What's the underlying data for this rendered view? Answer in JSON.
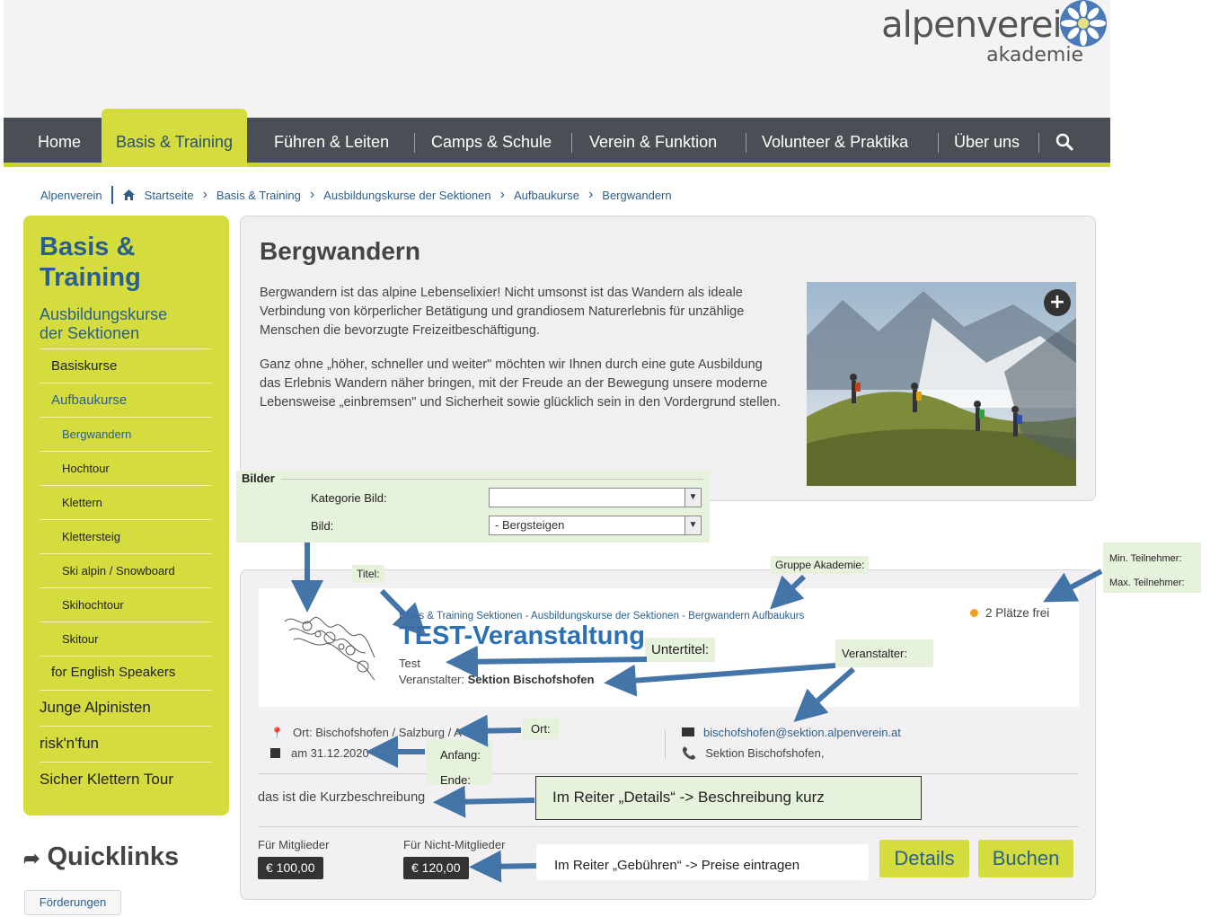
{
  "header": {
    "logo_main": "alpenverein",
    "logo_sub": "akademie"
  },
  "nav": {
    "items": [
      {
        "label": "Home"
      },
      {
        "label": "Basis & Training"
      },
      {
        "label": "Führen & Leiten"
      },
      {
        "label": "Camps & Schule"
      },
      {
        "label": "Verein & Funktion"
      },
      {
        "label": "Volunteer & Praktika"
      },
      {
        "label": "Über uns"
      }
    ],
    "search_icon": "search-icon"
  },
  "breadcrumb": {
    "root": "Alpenverein",
    "items": [
      "Startseite",
      "Basis & Training",
      "Ausbildungskurse der Sektionen",
      "Aufbaukurse",
      "Bergwandern"
    ]
  },
  "sidebar": {
    "title": "Basis & Training",
    "subtitle": "Ausbildungskurse der Sektionen",
    "items": [
      {
        "label": "Basiskurse"
      },
      {
        "label": "Aufbaukurse"
      },
      {
        "label": "Bergwandern"
      },
      {
        "label": "Hochtour"
      },
      {
        "label": "Klettern"
      },
      {
        "label": "Klettersteig"
      },
      {
        "label": "Ski alpin / Snowboard"
      },
      {
        "label": "Skihochtour"
      },
      {
        "label": "Skitour"
      },
      {
        "label": "for English Speakers"
      },
      {
        "label": "Junge Alpinisten"
      },
      {
        "label": "risk'n'fun"
      },
      {
        "label": "Sicher Klettern Tour"
      }
    ]
  },
  "quicklinks": {
    "title": "Quicklinks",
    "button": "Förderungen"
  },
  "main": {
    "title": "Bergwandern",
    "paragraphs": [
      "Bergwandern ist das alpine Lebenselixier! Nicht umsonst ist das Wandern als ideale Verbindung von körperlicher Betätigung und grandiosem Naturerlebnis für unzählige Menschen die bevorzugte Freizeitbeschäftigung.",
      "Ganz ohne „höher, schneller und weiter\" möchten wir Ihnen durch eine gute Ausbildung das Erlebnis Wandern näher bringen, mit der Freude an der Bewegung unsere moderne Lebensweise „einbremsen\" und Sicherheit sowie glücklich sein in den Vordergrund stellen."
    ],
    "plus": "+"
  },
  "bilder": {
    "title": "Bilder",
    "kategorie_label": "Kategorie Bild:",
    "kategorie_value": "",
    "bild_label": "Bild:",
    "bild_value": "- Bergsteigen"
  },
  "event": {
    "crumb": "Basis & Training Sektionen - Ausbildungskurse der Sektionen - Bergwandern Aufbaukurs",
    "title": "TEST-Veranstaltung",
    "subtitle": "Test",
    "org_label": "Veranstalter:",
    "org_value": "Sektion Bischofshofen",
    "free": "2 Plätze frei",
    "ort": "Ort: Bischofshofen / Salzburg / A",
    "date": "am 31.12.2020",
    "email": "bischofshofen@sektion.alpenverein.at",
    "phone": "Sektion Bischofshofen,",
    "description": "das ist die Kurzbeschreibung",
    "price_member_label": "Für Mitglieder",
    "price_member": "€ 100,00",
    "price_nonmember_label": "Für Nicht-Mitglieder",
    "price_nonmember": "€ 120,00",
    "details_button": "Details",
    "book_button": "Buchen"
  },
  "annotations": {
    "titel": "Titel:",
    "gruppe": "Gruppe Akademie:",
    "min": "Min. Teilnehmer:",
    "max": "Max. Teilnehmer:",
    "untertitel": "Untertitel:",
    "veranstalter": "Veranstalter:",
    "ort": "Ort:",
    "anfang": "Anfang:",
    "ende": "Ende:",
    "details_note": "Im Reiter „Details“ -> Beschreibung kurz",
    "gebuehren_note": "Im Reiter „Gebühren“ -> Preise eintragen"
  }
}
